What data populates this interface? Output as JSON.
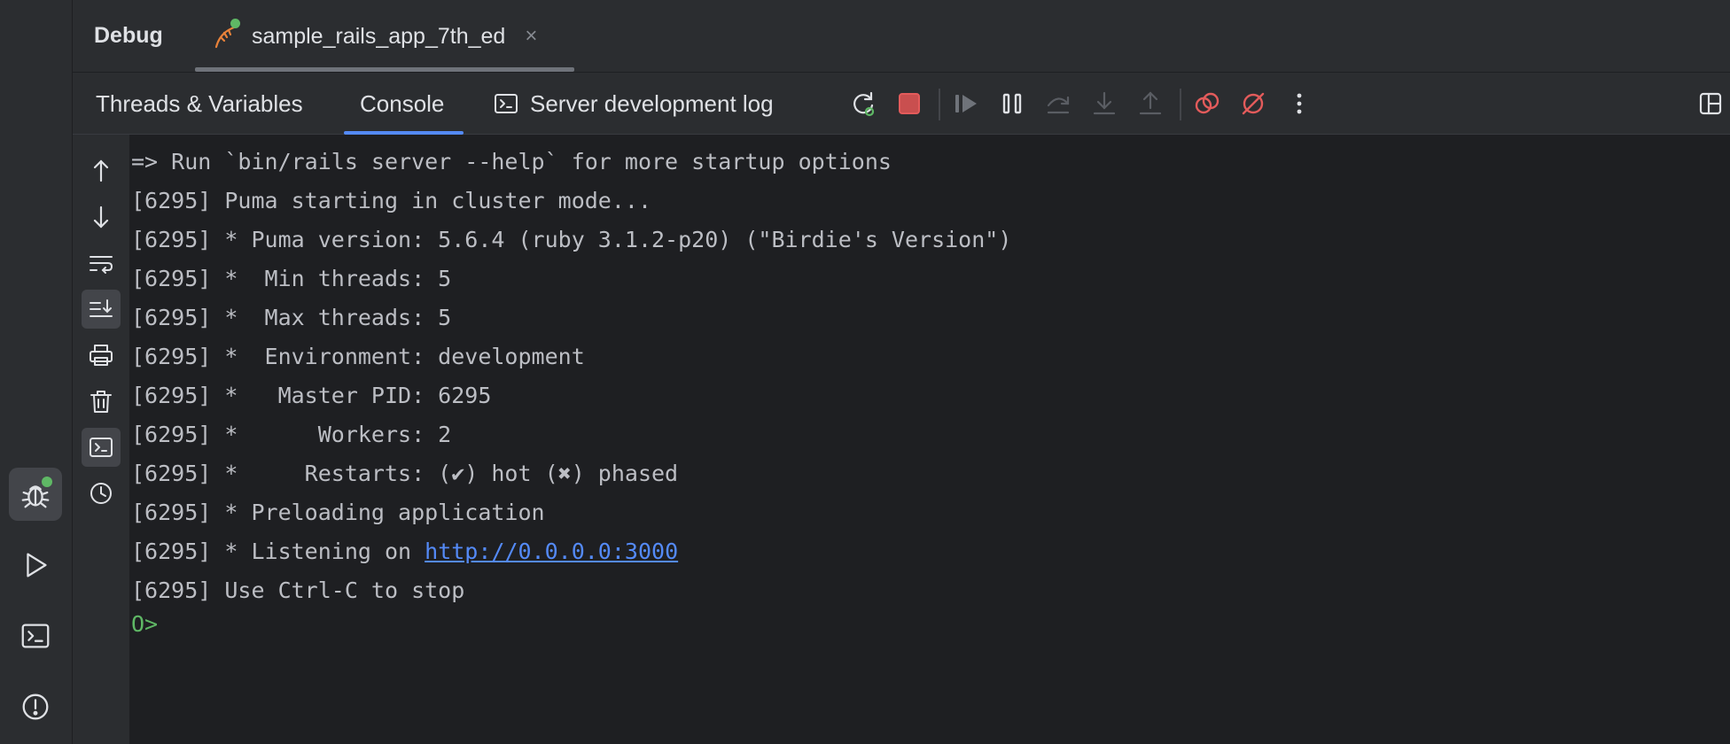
{
  "tabbar": {
    "title": "Debug",
    "session_tab": "sample_rails_app_7th_ed",
    "close_glyph": "×"
  },
  "toolbar": {
    "tabs": [
      "Threads & Variables",
      "Console",
      "Server development log"
    ],
    "active_tab": "Console",
    "icons": [
      "rerun-debug-icon",
      "stop-icon",
      "resume-icon",
      "pause-icon",
      "step-over-icon",
      "step-into-icon",
      "step-out-icon",
      "view-breakpoints-icon",
      "mute-breakpoints-icon",
      "more-icon",
      "layout-icon"
    ]
  },
  "console": {
    "lines": [
      "=> Run `bin/rails server --help` for more startup options",
      "[6295] Puma starting in cluster mode...",
      "[6295] * Puma version: 5.6.4 (ruby 3.1.2-p20) (\"Birdie's Version\")",
      "[6295] *  Min threads: 5",
      "[6295] *  Max threads: 5",
      "[6295] *  Environment: development",
      "[6295] *   Master PID: 6295",
      "[6295] *      Workers: 2",
      "[6295] *     Restarts: (✔) hot (✖) phased",
      "[6295] * Preloading application"
    ],
    "listening_prefix": "[6295] * Listening on ",
    "listening_url": "http://0.0.0.0:3000",
    "stop_line": "[6295] Use Ctrl-C to stop",
    "prompt": "O>"
  },
  "colors": {
    "accent": "#548af7",
    "stop_red": "#e35b5b",
    "status_green": "#5fb865"
  }
}
